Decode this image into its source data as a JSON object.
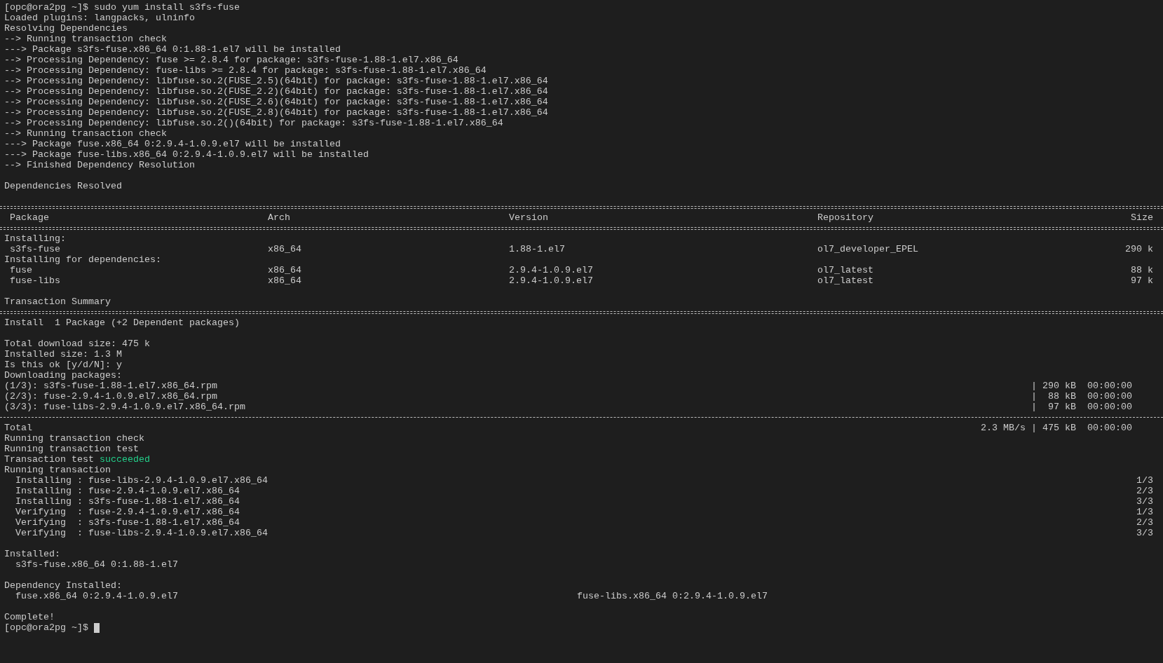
{
  "terminal": {
    "lines": [
      {
        "kind": "text",
        "text": "[opc@ora2pg ~]$ sudo yum install s3fs-fuse"
      },
      {
        "kind": "text",
        "text": "Loaded plugins: langpacks, ulninfo"
      },
      {
        "kind": "text",
        "text": "Resolving Dependencies"
      },
      {
        "kind": "text",
        "text": "--> Running transaction check"
      },
      {
        "kind": "text",
        "text": "---> Package s3fs-fuse.x86_64 0:1.88-1.el7 will be installed"
      },
      {
        "kind": "text",
        "text": "--> Processing Dependency: fuse >= 2.8.4 for package: s3fs-fuse-1.88-1.el7.x86_64"
      },
      {
        "kind": "text",
        "text": "--> Processing Dependency: fuse-libs >= 2.8.4 for package: s3fs-fuse-1.88-1.el7.x86_64"
      },
      {
        "kind": "text",
        "text": "--> Processing Dependency: libfuse.so.2(FUSE_2.5)(64bit) for package: s3fs-fuse-1.88-1.el7.x86_64"
      },
      {
        "kind": "text",
        "text": "--> Processing Dependency: libfuse.so.2(FUSE_2.2)(64bit) for package: s3fs-fuse-1.88-1.el7.x86_64"
      },
      {
        "kind": "text",
        "text": "--> Processing Dependency: libfuse.so.2(FUSE_2.6)(64bit) for package: s3fs-fuse-1.88-1.el7.x86_64"
      },
      {
        "kind": "text",
        "text": "--> Processing Dependency: libfuse.so.2(FUSE_2.8)(64bit) for package: s3fs-fuse-1.88-1.el7.x86_64"
      },
      {
        "kind": "text",
        "text": "--> Processing Dependency: libfuse.so.2()(64bit) for package: s3fs-fuse-1.88-1.el7.x86_64"
      },
      {
        "kind": "text",
        "text": "--> Running transaction check"
      },
      {
        "kind": "text",
        "text": "---> Package fuse.x86_64 0:2.9.4-1.0.9.el7 will be installed"
      },
      {
        "kind": "text",
        "text": "---> Package fuse-libs.x86_64 0:2.9.4-1.0.9.el7 will be installed"
      },
      {
        "kind": "text",
        "text": "--> Finished Dependency Resolution"
      },
      {
        "kind": "blank"
      },
      {
        "kind": "text",
        "text": "Dependencies Resolved"
      },
      {
        "kind": "blank"
      },
      {
        "kind": "double_rule"
      },
      {
        "kind": "table_header",
        "cells": [
          "Package",
          "Arch",
          "Version",
          "Repository",
          "Size"
        ]
      },
      {
        "kind": "double_rule"
      },
      {
        "kind": "text",
        "text": "Installing:"
      },
      {
        "kind": "table_row",
        "cells": [
          "s3fs-fuse",
          "x86_64",
          "1.88-1.el7",
          "ol7_developer_EPEL",
          "290 k"
        ]
      },
      {
        "kind": "text",
        "text": "Installing for dependencies:"
      },
      {
        "kind": "table_row",
        "cells": [
          "fuse",
          "x86_64",
          "2.9.4-1.0.9.el7",
          "ol7_latest",
          "88 k"
        ]
      },
      {
        "kind": "table_row",
        "cells": [
          "fuse-libs",
          "x86_64",
          "2.9.4-1.0.9.el7",
          "ol7_latest",
          "97 k"
        ]
      },
      {
        "kind": "blank"
      },
      {
        "kind": "text",
        "text": "Transaction Summary"
      },
      {
        "kind": "double_rule"
      },
      {
        "kind": "text",
        "text": "Install  1 Package (+2 Dependent packages)"
      },
      {
        "kind": "blank"
      },
      {
        "kind": "text",
        "text": "Total download size: 475 k"
      },
      {
        "kind": "text",
        "text": "Installed size: 1.3 M"
      },
      {
        "kind": "text",
        "text": "Is this ok [y/d/N]: y"
      },
      {
        "kind": "text",
        "text": "Downloading packages:"
      },
      {
        "kind": "progress",
        "left": "(1/3): s3fs-fuse-1.88-1.el7.x86_64.rpm",
        "right": "| 290 kB  00:00:00"
      },
      {
        "kind": "progress",
        "left": "(2/3): fuse-2.9.4-1.0.9.el7.x86_64.rpm",
        "right": "|  88 kB  00:00:00"
      },
      {
        "kind": "progress",
        "left": "(3/3): fuse-libs-2.9.4-1.0.9.el7.x86_64.rpm",
        "right": "|  97 kB  00:00:00"
      },
      {
        "kind": "single_rule"
      },
      {
        "kind": "progress",
        "left": "Total",
        "right": "2.3 MB/s | 475 kB  00:00:00"
      },
      {
        "kind": "text",
        "text": "Running transaction check"
      },
      {
        "kind": "text",
        "text": "Running transaction test"
      },
      {
        "kind": "status",
        "text": "Transaction test ",
        "status": "succeeded",
        "color": "#23d18b"
      },
      {
        "kind": "text",
        "text": "Running transaction"
      },
      {
        "kind": "step",
        "left": "  Installing : fuse-libs-2.9.4-1.0.9.el7.x86_64",
        "right": "1/3"
      },
      {
        "kind": "step",
        "left": "  Installing : fuse-2.9.4-1.0.9.el7.x86_64",
        "right": "2/3"
      },
      {
        "kind": "step",
        "left": "  Installing : s3fs-fuse-1.88-1.el7.x86_64",
        "right": "3/3"
      },
      {
        "kind": "step",
        "left": "  Verifying  : fuse-2.9.4-1.0.9.el7.x86_64",
        "right": "1/3"
      },
      {
        "kind": "step",
        "left": "  Verifying  : s3fs-fuse-1.88-1.el7.x86_64",
        "right": "2/3"
      },
      {
        "kind": "step",
        "left": "  Verifying  : fuse-libs-2.9.4-1.0.9.el7.x86_64",
        "right": "3/3"
      },
      {
        "kind": "blank"
      },
      {
        "kind": "text",
        "text": "Installed:"
      },
      {
        "kind": "text",
        "text": "  s3fs-fuse.x86_64 0:1.88-1.el7"
      },
      {
        "kind": "blank"
      },
      {
        "kind": "text",
        "text": "Dependency Installed:"
      },
      {
        "kind": "pair",
        "left": "  fuse.x86_64 0:2.9.4-1.0.9.el7",
        "right": "fuse-libs.x86_64 0:2.9.4-1.0.9.el7"
      },
      {
        "kind": "blank"
      },
      {
        "kind": "text",
        "text": "Complete!"
      },
      {
        "kind": "prompt",
        "text": "[opc@ora2pg ~]$ ",
        "cursor": true
      }
    ]
  }
}
